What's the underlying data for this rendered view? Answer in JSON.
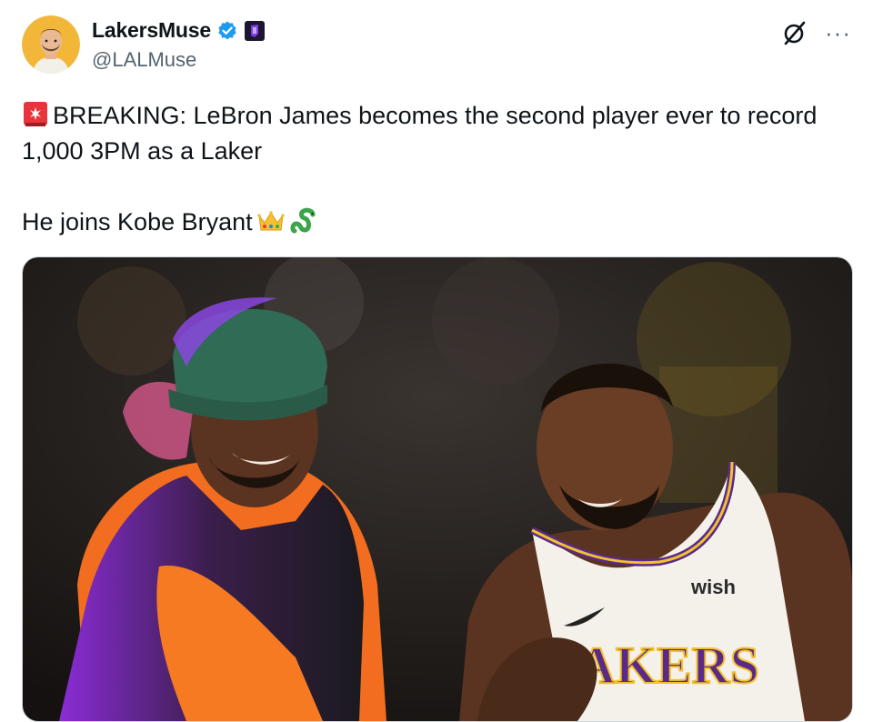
{
  "author": {
    "display_name": "LakersMuse",
    "handle": "@LALMuse",
    "avatar_icon": "cartoon-man-avatar",
    "verified_icon": "verified-badge-icon",
    "affiliation_icon": "purple-affiliate-badge-icon"
  },
  "actions": {
    "grok_icon": "grok-slash-icon",
    "more_label": "···"
  },
  "tweet": {
    "line1_emoji": "rotating-light-emoji",
    "line1": "BREAKING: LeBron James becomes the second player ever to record 1,000 3PM as a Laker",
    "line2": "He joins Kobe Bryant",
    "line2_emojis": [
      "crown-emoji",
      "snake-emoji"
    ]
  },
  "media": {
    "jersey_text": "AKERS",
    "sponsor_text": "wish"
  },
  "colors": {
    "verified_blue": "#1d9bf0",
    "affiliate_purple": "#5b2a86",
    "handle_gray": "#536471"
  }
}
